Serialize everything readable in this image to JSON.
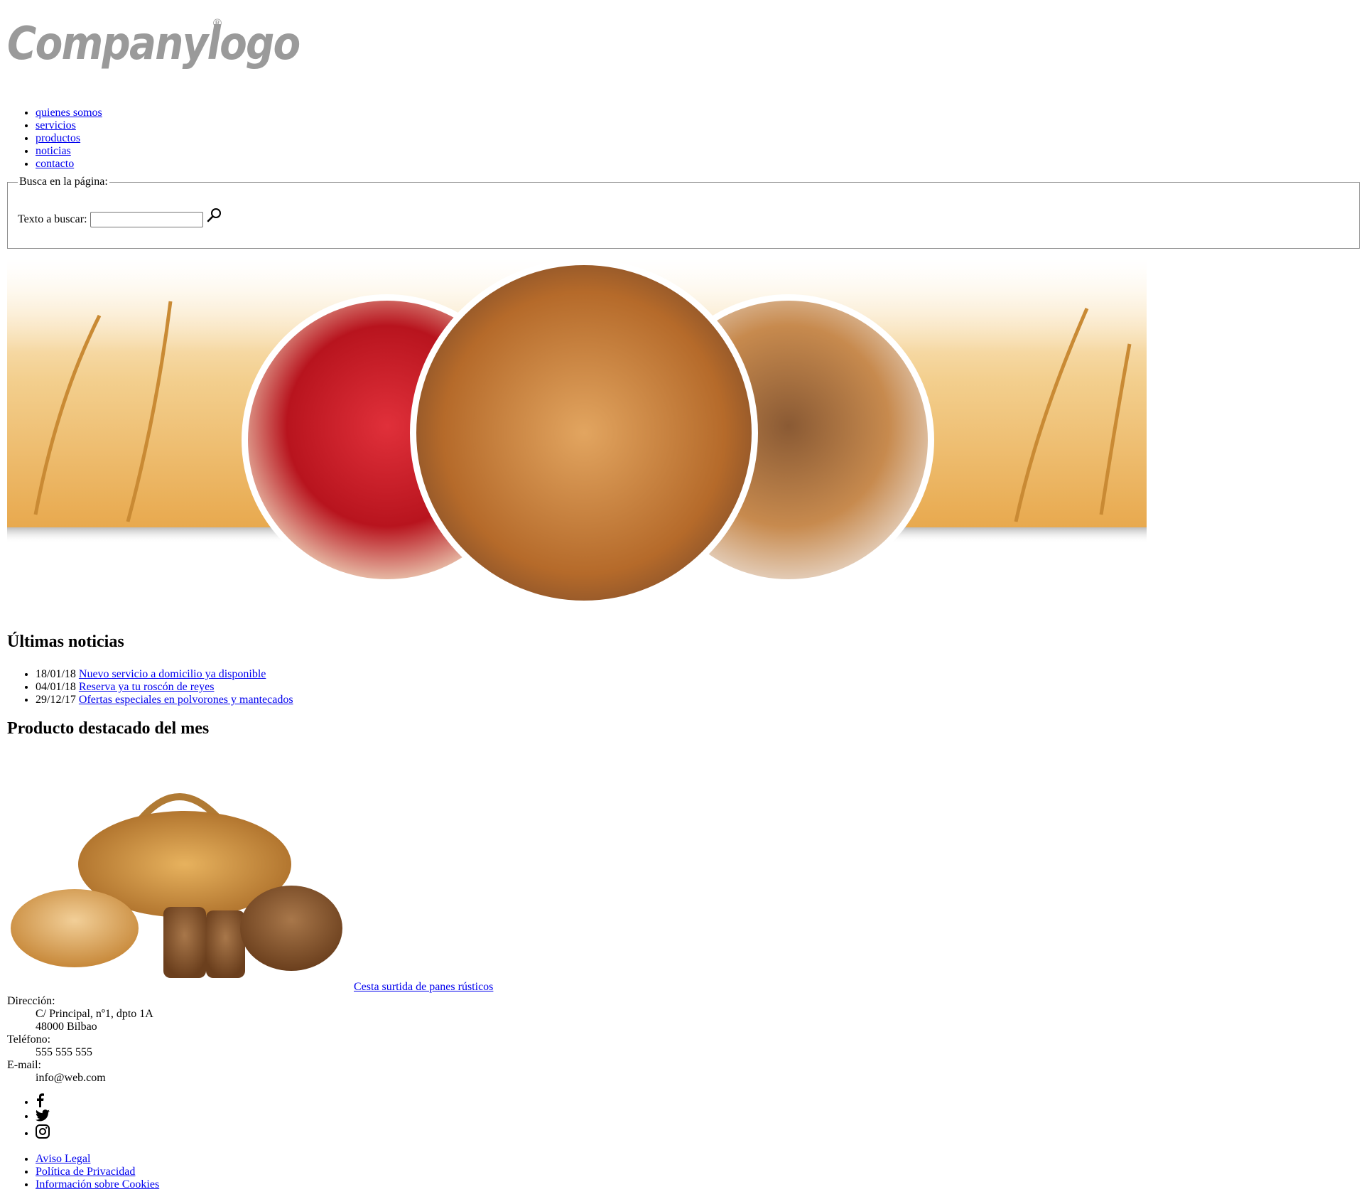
{
  "logo": {
    "text": "Companylogo",
    "registered": "®"
  },
  "nav": {
    "items": [
      {
        "label": "quienes somos"
      },
      {
        "label": "servicios"
      },
      {
        "label": "productos"
      },
      {
        "label": "noticias"
      },
      {
        "label": "contacto"
      }
    ]
  },
  "search": {
    "legend": "Busca en la página:",
    "label": "Texto a buscar:",
    "value": "",
    "button_icon": "magnifier-icon"
  },
  "hero": {
    "images": [
      "wheat-field-background",
      "strawberry-tart-photo",
      "croissants-basket-photo",
      "assorted-tarts-photo"
    ]
  },
  "news": {
    "title": "Últimas noticias",
    "items": [
      {
        "date": "18/01/18",
        "label": "Nuevo servicio a domicilio ya disponible"
      },
      {
        "date": "04/01/18",
        "label": "Reserva ya tu roscón de reyes"
      },
      {
        "date": "29/12/17",
        "label": "Ofertas especiales en polvorones y mantecados"
      }
    ]
  },
  "featured": {
    "title": "Producto destacado del mes",
    "image": "bread-basket-photo",
    "link": "Cesta surtida de panes rústicos"
  },
  "contact": {
    "address_label": "Dirección:",
    "address_line1": "C/ Principal, nº1, dpto 1A",
    "address_line2": "48000 Bilbao",
    "phone_label": "Teléfono:",
    "phone": "555 555 555",
    "email_label": "E-mail:",
    "email": "info@web.com"
  },
  "social": {
    "icons": [
      "facebook-icon",
      "twitter-icon",
      "instagram-icon"
    ]
  },
  "legal": {
    "items": [
      {
        "label": "Aviso Legal"
      },
      {
        "label": "Política de Privacidad"
      },
      {
        "label": "Información sobre Cookies"
      }
    ]
  },
  "colors": {
    "link": "#0000ee",
    "logo_gray": "#9a9a9a",
    "wheat": "#e8b463"
  }
}
